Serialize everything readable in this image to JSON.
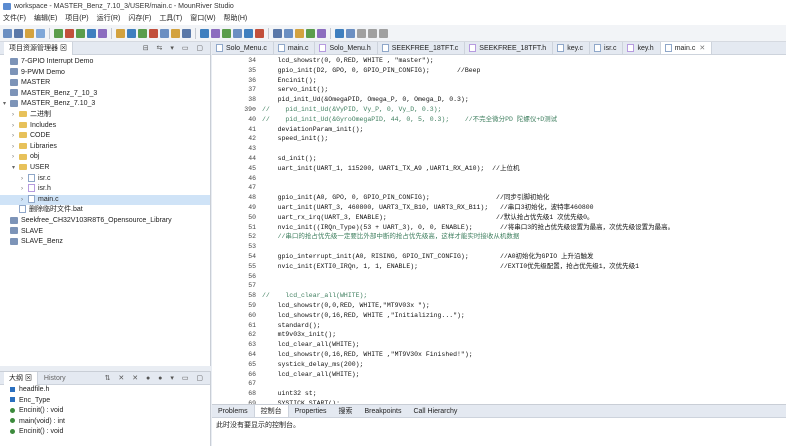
{
  "window": {
    "title": "workspace - MASTER_Benz_7.10_3/USER/main.c - MounRiver Studio"
  },
  "menu": [
    "文件(F)",
    "编辑(E)",
    "项目(P)",
    "运行(R)",
    "闪存(F)",
    "工具(T)",
    "窗口(W)",
    "帮助(H)"
  ],
  "explorer": {
    "tab_label": "项目资源管理器",
    "items": [
      {
        "label": "7-GPIO Interrupt Demo",
        "type": "project",
        "depth": 0,
        "twisty": ""
      },
      {
        "label": "9-PWM Demo",
        "type": "project",
        "depth": 0,
        "twisty": ""
      },
      {
        "label": "MASTER",
        "type": "project",
        "depth": 0,
        "twisty": ""
      },
      {
        "label": "MASTER_Benz_7_10_3",
        "type": "project",
        "depth": 0,
        "twisty": ""
      },
      {
        "label": "MASTER_Benz_7.10_3",
        "type": "project",
        "depth": 0,
        "twisty": "▾"
      },
      {
        "label": "二进制",
        "type": "folder",
        "depth": 1,
        "twisty": "›"
      },
      {
        "label": "Includes",
        "type": "folder",
        "depth": 1,
        "twisty": "›"
      },
      {
        "label": "CODE",
        "type": "folder",
        "depth": 1,
        "twisty": "›"
      },
      {
        "label": "Libraries",
        "type": "folder",
        "depth": 1,
        "twisty": "›"
      },
      {
        "label": "obj",
        "type": "folder",
        "depth": 1,
        "twisty": "›"
      },
      {
        "label": "USER",
        "type": "folder",
        "depth": 1,
        "twisty": "▾"
      },
      {
        "label": "isr.c",
        "type": "cfile",
        "depth": 2,
        "twisty": "›"
      },
      {
        "label": "isr.h",
        "type": "hfile",
        "depth": 2,
        "twisty": "›"
      },
      {
        "label": "main.c",
        "type": "cfile",
        "depth": 2,
        "twisty": "›",
        "selected": true
      },
      {
        "label": "删除临时文件.bat",
        "type": "file",
        "depth": 1,
        "twisty": ""
      },
      {
        "label": "Seekfree_CH32V103R8T6_Opensource_Library",
        "type": "project",
        "depth": 0,
        "twisty": ""
      },
      {
        "label": "SLAVE",
        "type": "project",
        "depth": 0,
        "twisty": ""
      },
      {
        "label": "SLAVE_Benz",
        "type": "project",
        "depth": 0,
        "twisty": ""
      }
    ]
  },
  "outline": {
    "tabs": [
      "大纲",
      "History"
    ],
    "items": [
      {
        "label": "headfile.h",
        "kind": "include"
      },
      {
        "label": "Enc_Type",
        "kind": "type"
      },
      {
        "label": "Encinit() : void",
        "kind": "func"
      },
      {
        "label": "main(void) : int",
        "kind": "func"
      },
      {
        "label": "Encinit() : void",
        "kind": "func"
      }
    ]
  },
  "editor": {
    "tabs": [
      {
        "label": "Solo_Menu.c",
        "active": false
      },
      {
        "label": "main.c",
        "active": false
      },
      {
        "label": "Solo_Menu.h",
        "active": false
      },
      {
        "label": "SEEKFREE_18TFT.c",
        "active": false
      },
      {
        "label": "SEEKFREE_18TFT.h",
        "active": false
      },
      {
        "label": "key.c",
        "active": false
      },
      {
        "label": "isr.c",
        "active": false
      },
      {
        "label": "key.h",
        "active": false
      },
      {
        "label": "main.c",
        "active": true
      }
    ],
    "lines": [
      {
        "n": "34",
        "t": "    lcd_showstr(0, 0,RED, WHITE , \"master\");",
        "s": ""
      },
      {
        "n": "35",
        "t": "    gpio_init(D2, GPO, 0, GPIO_PIN_CONFIG);       //Beep",
        "s": ""
      },
      {
        "n": "36",
        "t": "    Encinit();",
        "s": ""
      },
      {
        "n": "37",
        "t": "    servo_init();",
        "s": ""
      },
      {
        "n": "38",
        "t": "    pid_init_Ud(&OmegaPID, Omega_P, 0, Omega_D, 0.3);",
        "s": ""
      },
      {
        "n": "39⊖",
        "t": "//    pid_init_Ud(&VyPID, Vy_P, 0, Vy_D, 0.3);",
        "s": "cm"
      },
      {
        "n": "40",
        "t": "//    pid_init_Ud(&GyroOmegaPID, 44, 0, 5, 0.3);    //不完全微分PD 陀螺仪+D测试",
        "s": "cm"
      },
      {
        "n": "41",
        "t": "    deviationParam_init();",
        "s": ""
      },
      {
        "n": "42",
        "t": "    speed_init();",
        "s": ""
      },
      {
        "n": "43",
        "t": "",
        "s": ""
      },
      {
        "n": "44",
        "t": "    sd_init();",
        "s": ""
      },
      {
        "n": "45",
        "t": "    uart_init(UART_1, 115200, UART1_TX_A9 ,UART1_RX_A10);  //上位机",
        "s": ""
      },
      {
        "n": "46",
        "t": "",
        "s": ""
      },
      {
        "n": "47",
        "t": "",
        "s": ""
      },
      {
        "n": "48",
        "t": "    gpio_init(A0, GPO, 0, GPIO_PIN_CONFIG);                 //同步引脚初始化",
        "s": ""
      },
      {
        "n": "49",
        "t": "    uart_init(UART_3, 460800, UART3_TX_B10, UART3_RX_B11);   //串口3初始化，波特率460800",
        "s": ""
      },
      {
        "n": "50",
        "t": "    uart_rx_irq(UART_3, ENABLE);                            //默认抢占优先级1 次优先级0。",
        "s": ""
      },
      {
        "n": "51",
        "t": "    nvic_init((IRQn_Type)(53 + UART_3), 0, 0, ENABLE);       //将串口3的抢占优先级设置为最高，次优先级设置为最高。",
        "s": ""
      },
      {
        "n": "52",
        "t": "    //串口的抢占优先级一定要比外部中断的抢占优先级高，这样才能实时接收从机数据",
        "s": "cm"
      },
      {
        "n": "53",
        "t": "",
        "s": ""
      },
      {
        "n": "54",
        "t": "    gpio_interrupt_init(A0, RISING, GPIO_INT_CONFIG);        //A0初始化为GPIO 上升沿触发",
        "s": ""
      },
      {
        "n": "55",
        "t": "    nvic_init(EXTI0_IRQn, 1, 1, ENABLE);                     //EXTI0优先级配置，抢占优先级1，次优先级1",
        "s": ""
      },
      {
        "n": "56",
        "t": "",
        "s": ""
      },
      {
        "n": "57",
        "t": "",
        "s": ""
      },
      {
        "n": "58",
        "t": "//    lcd_clear_all(WHITE);",
        "s": "cm"
      },
      {
        "n": "59",
        "t": "    lcd_showstr(0,0,RED, WHITE,\"MT9V03x \");",
        "s": ""
      },
      {
        "n": "60",
        "t": "    lcd_showstr(0,16,RED, WHITE ,\"Initializing...\");",
        "s": ""
      },
      {
        "n": "61",
        "t": "    standard();",
        "s": ""
      },
      {
        "n": "62",
        "t": "    mt9v03x_init();",
        "s": ""
      },
      {
        "n": "63",
        "t": "    lcd_clear_all(WHITE);",
        "s": ""
      },
      {
        "n": "64",
        "t": "    lcd_showstr(0,16,RED, WHITE ,\"MT9V30x Finished!\");",
        "s": ""
      },
      {
        "n": "65",
        "t": "    systick_delay_ms(200);",
        "s": ""
      },
      {
        "n": "66",
        "t": "    lcd_clear_all(WHITE);",
        "s": ""
      },
      {
        "n": "67",
        "t": "",
        "s": ""
      },
      {
        "n": "68",
        "t": "    uint32 st;",
        "s": ""
      },
      {
        "n": "69",
        "t": "    SYSTICK_START();",
        "s": ""
      }
    ]
  },
  "bottom": {
    "tabs": [
      {
        "label": "Problems",
        "active": false
      },
      {
        "label": "控制台",
        "active": true
      },
      {
        "label": "Properties",
        "active": false
      },
      {
        "label": "搜索",
        "active": false
      },
      {
        "label": "Breakpoints",
        "active": false
      },
      {
        "label": "Call Hierarchy",
        "active": false
      }
    ],
    "console_text": "此时没有要显示的控制台。"
  }
}
